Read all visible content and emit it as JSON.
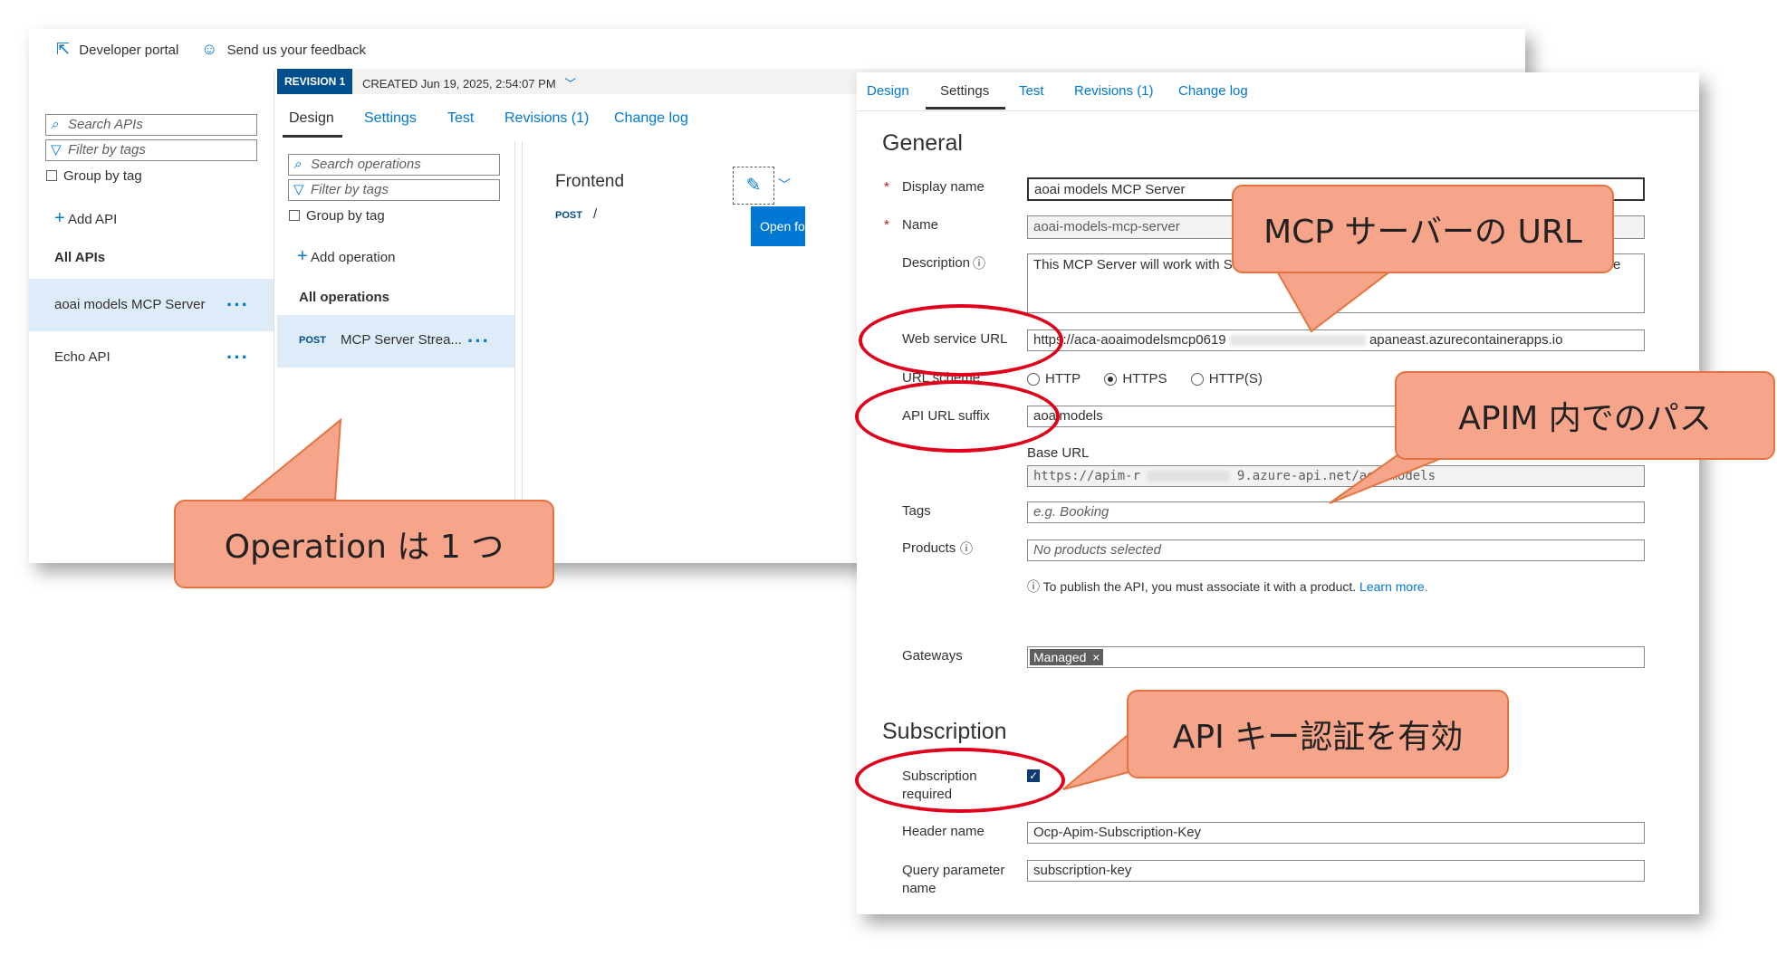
{
  "toolbar": {
    "developer_portal": "Developer portal",
    "feedback": "Send us your feedback"
  },
  "left_sidebar": {
    "search_placeholder": "Search APIs",
    "filter_placeholder": "Filter by tags",
    "group_by_tag": "Group by tag",
    "add_api": "Add API",
    "all_apis": "All APIs",
    "apis": [
      {
        "name": "aoai models MCP Server"
      },
      {
        "name": "Echo API"
      }
    ]
  },
  "revision_bar": {
    "badge": "REVISION 1",
    "created": "CREATED Jun 19, 2025, 2:54:07 PM"
  },
  "main_tabs": [
    "Design",
    "Settings",
    "Test",
    "Revisions (1)",
    "Change log"
  ],
  "operations": {
    "search_placeholder": "Search operations",
    "filter_placeholder": "Filter by tags",
    "group_by_tag": "Group by tag",
    "add_operation": "Add operation",
    "all_operations": "All operations",
    "item_method": "POST",
    "item_name": "MCP Server Strea..."
  },
  "frontend": {
    "title": "Frontend",
    "method": "POST",
    "path": "/",
    "open_button": "Open fo"
  },
  "settings_tabs": [
    "Design",
    "Settings",
    "Test",
    "Revisions (1)",
    "Change log"
  ],
  "general": {
    "heading": "General",
    "display_name_label": "Display name",
    "display_name_value": "aoai models MCP Server",
    "name_label": "Name",
    "name_value": "aoai-models-mcp-server",
    "description_label": "Description",
    "description_value": "This MCP Server will work with Stre",
    "description_tail": "e",
    "web_service_url_label": "Web service URL",
    "web_service_url_prefix": "https://aca-aoaimodelsmcp0619",
    "web_service_url_suffix": "apaneast.azurecontainerapps.io",
    "url_scheme_label": "URL scheme",
    "scheme_options": [
      "HTTP",
      "HTTPS",
      "HTTP(S)"
    ],
    "scheme_selected": "HTTPS",
    "api_url_suffix_label": "API URL suffix",
    "api_url_suffix_value": "aoaimodels",
    "base_url_label": "Base URL",
    "base_url_prefix": "https://apim-r",
    "base_url_suffix": "9.azure-api.net/aoaimodels",
    "tags_label": "Tags",
    "tags_placeholder": "e.g. Booking",
    "products_label": "Products",
    "products_placeholder": "No products selected",
    "publish_note": "To publish the API, you must associate it with a product.",
    "learn_more": "Learn more.",
    "gateways_label": "Gateways",
    "gateway_chip": "Managed"
  },
  "subscription": {
    "heading": "Subscription",
    "required_label_1": "Subscription",
    "required_label_2": "required",
    "required_checked": true,
    "header_name_label": "Header name",
    "header_name_value": "Ocp-Apim-Subscription-Key",
    "query_param_label_1": "Query parameter",
    "query_param_label_2": "name",
    "query_param_value": "subscription-key"
  },
  "callouts": {
    "operation": "Operation は 1 つ",
    "mcp_url": "MCP サーバーの URL",
    "apim_path": "APIM 内でのパス",
    "api_key": "API キー認証を有効"
  },
  "colors": {
    "accent": "#0078d4",
    "callout_fill": "#f6a58a",
    "callout_border": "#e5733f",
    "highlight_ring": "#e0001a",
    "revision_badge": "#004e8c"
  }
}
